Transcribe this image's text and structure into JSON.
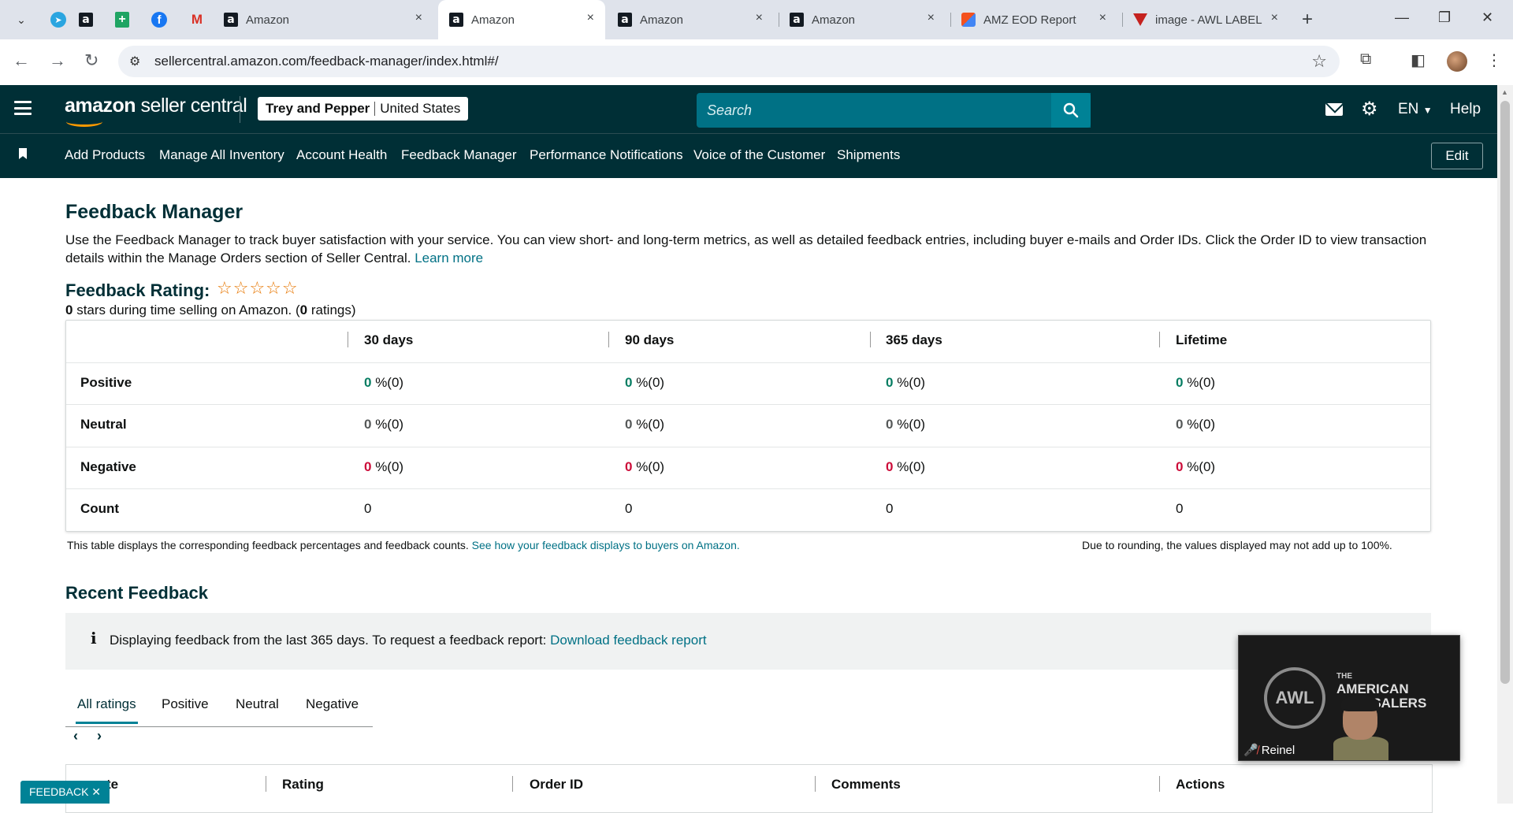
{
  "browser": {
    "tabs": [
      {
        "title": "Amazon",
        "close": "×"
      },
      {
        "title": "Amazon",
        "close": "×"
      },
      {
        "title": "Amazon",
        "close": "×"
      },
      {
        "title": "Amazon",
        "close": "×"
      },
      {
        "title": "AMZ EOD Report",
        "close": "×"
      },
      {
        "title": "image - AWL LABEL",
        "close": "×"
      }
    ],
    "active_tab_index": 1,
    "url": "sellercentral.amazon.com/feedback-manager/index.html#/"
  },
  "header": {
    "logo_text_bold": "amazon",
    "logo_text": " seller central",
    "store_name": "Trey and Pepper",
    "store_region": "United States",
    "search_placeholder": "Search",
    "language": "EN",
    "help_label": "Help"
  },
  "nav": {
    "links": [
      "Add Products",
      "Manage All Inventory",
      "Account Health",
      "Feedback Manager",
      "Performance Notifications",
      "Voice of the Customer",
      "Shipments"
    ],
    "edit_label": "Edit"
  },
  "page": {
    "title": "Feedback Manager",
    "description": "Use the Feedback Manager to track buyer satisfaction with your service. You can view short- and long-term metrics, as well as detailed feedback entries, including buyer e-mails and Order IDs. Click the Order ID to view transaction details within the Manage Orders section of Seller Central.",
    "learn_more": "Learn more",
    "rating_title": "Feedback Rating:",
    "stars_display": "☆☆☆☆☆",
    "stars_value": 0,
    "stars_max": 5,
    "rating_stars": "0",
    "rating_sub_mid": " stars during time selling on Amazon. (",
    "rating_count": "0",
    "rating_sub_end": " ratings)"
  },
  "feedback_table": {
    "columns": [
      "30 days",
      "90 days",
      "365 days",
      "Lifetime"
    ],
    "rows": [
      {
        "label": "Positive",
        "cells": [
          {
            "num": "0",
            "pct": " %(0)"
          },
          {
            "num": "0",
            "pct": " %(0)"
          },
          {
            "num": "0",
            "pct": " %(0)"
          },
          {
            "num": "0",
            "pct": " %(0)"
          }
        ]
      },
      {
        "label": "Neutral",
        "cells": [
          {
            "num": "0",
            "pct": " %(0)"
          },
          {
            "num": "0",
            "pct": " %(0)"
          },
          {
            "num": "0",
            "pct": " %(0)"
          },
          {
            "num": "0",
            "pct": " %(0)"
          }
        ]
      },
      {
        "label": "Negative",
        "cells": [
          {
            "num": "0",
            "pct": " %(0)"
          },
          {
            "num": "0",
            "pct": " %(0)"
          },
          {
            "num": "0",
            "pct": " %(0)"
          },
          {
            "num": "0",
            "pct": " %(0)"
          }
        ]
      },
      {
        "label": "Count",
        "cells": [
          "0",
          "0",
          "0",
          "0"
        ]
      }
    ],
    "footnote_left": "This table displays the corresponding feedback percentages and feedback counts.",
    "footnote_link": "See how your feedback displays to buyers on Amazon.",
    "footnote_right": "Due to rounding, the values displayed may not add up to 100%.",
    "colors": {
      "positive": "#067d62",
      "neutral": "#565959",
      "negative": "#cc0c39"
    }
  },
  "recent": {
    "title": "Recent Feedback",
    "info_icon": "i",
    "info_text": "Displaying feedback from the last 365 days. To request a feedback report:",
    "info_link": "Download feedback report",
    "tabs": [
      "All ratings",
      "Positive",
      "Neutral",
      "Negative"
    ],
    "active_tab": "All ratings",
    "pager_prev": "‹",
    "pager_next": "›",
    "columns": [
      "te",
      "Rating",
      "Order ID",
      "Comments",
      "Actions"
    ]
  },
  "widgets": {
    "feedback_button": "FEEDBACK ✕",
    "video_name": "Reinel",
    "video_logo_mark": "AWL",
    "video_brand_top": "THE",
    "video_brand_line1": "AMERICAN",
    "video_brand_line2": "ESALERS"
  },
  "colors": {
    "header_bg": "#002f36",
    "accent": "#008296",
    "link": "#007185",
    "star": "#e77600"
  }
}
